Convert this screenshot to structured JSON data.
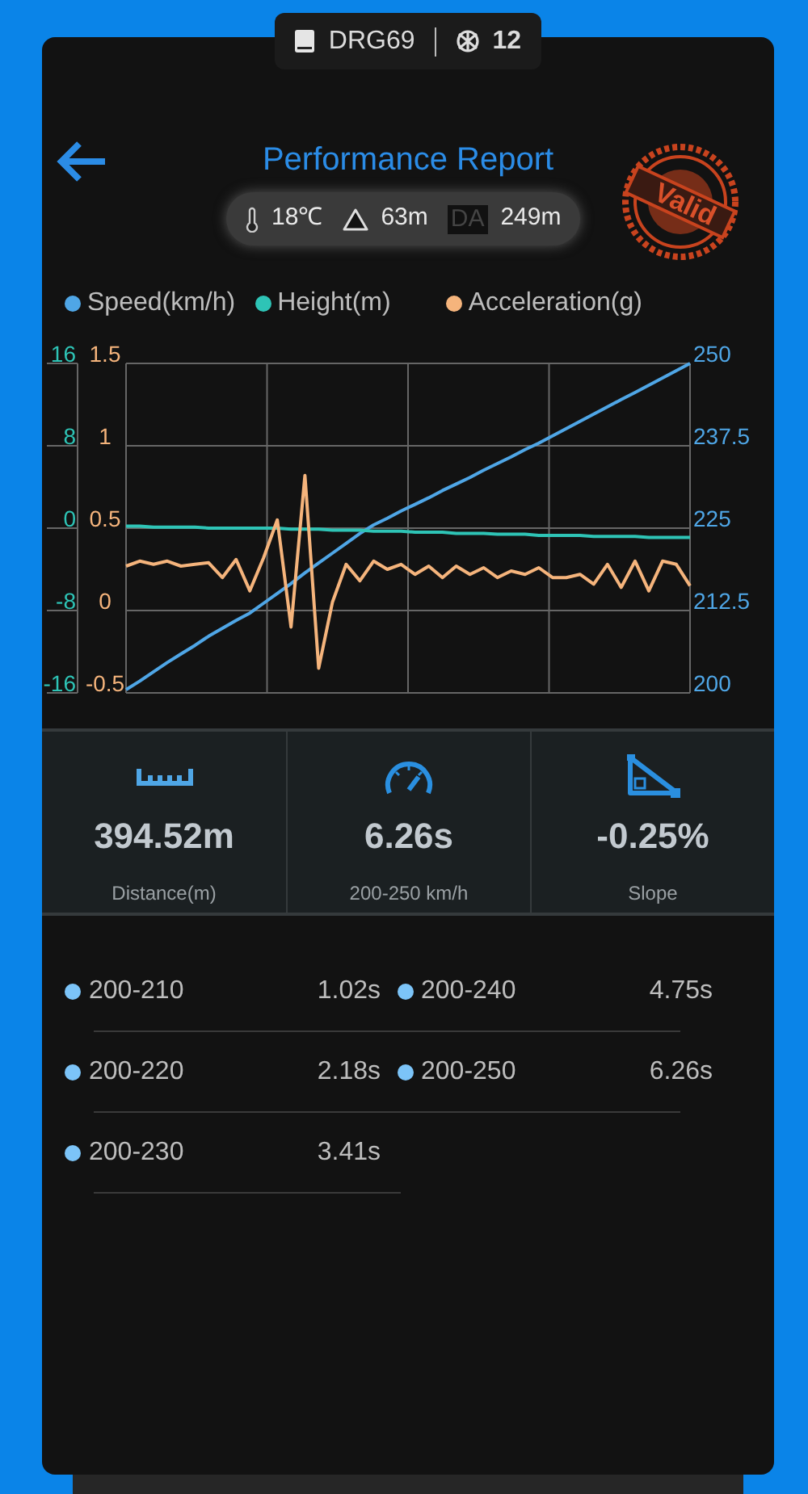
{
  "device": {
    "name": "DRG69",
    "satellites": "12"
  },
  "header": {
    "title": "Performance Report",
    "stamp": "Valid"
  },
  "conditions": {
    "temperature": "18℃",
    "altitude": "63m",
    "da_badge": "DA",
    "density_altitude": "249m"
  },
  "chart_data": {
    "type": "line",
    "grid": true,
    "ylim": [
      200,
      250
    ],
    "yticks": [
      200,
      212.5,
      225,
      237.5,
      250
    ],
    "y2lim": [
      -16,
      16
    ],
    "y2ticks": [
      -16,
      -8,
      0,
      8,
      16
    ],
    "y3lim": [
      -0.5,
      1.5
    ],
    "y3ticks": [
      -0.5,
      0,
      0.5,
      1,
      1.5
    ],
    "series": [
      {
        "name": "Speed(km/h)",
        "color": "#4fa6e6",
        "values": [
          200.5,
          201.8,
          203.2,
          204.6,
          205.9,
          207.2,
          208.6,
          209.8,
          211.0,
          212.1,
          213.6,
          215.1,
          216.6,
          218.2,
          219.7,
          221.2,
          222.7,
          224.2,
          225.5,
          226.5,
          227.6,
          228.6,
          229.6,
          230.7,
          231.7,
          232.7,
          233.8,
          234.8,
          235.8,
          236.9,
          237.9,
          239.0,
          240.1,
          241.2,
          242.3,
          243.4,
          244.5,
          245.6,
          246.7,
          247.8,
          248.9,
          250
        ]
      },
      {
        "name": "Height(m)",
        "color": "#2ec4b6",
        "axis": "y2",
        "values": [
          0.2,
          0.2,
          0.1,
          0.1,
          0.1,
          0.1,
          0.0,
          0.0,
          0.0,
          0.0,
          0.0,
          0.0,
          -0.1,
          -0.1,
          -0.1,
          -0.2,
          -0.2,
          -0.2,
          -0.3,
          -0.3,
          -0.3,
          -0.4,
          -0.4,
          -0.4,
          -0.5,
          -0.5,
          -0.5,
          -0.6,
          -0.6,
          -0.6,
          -0.7,
          -0.7,
          -0.7,
          -0.7,
          -0.8,
          -0.8,
          -0.8,
          -0.8,
          -0.9,
          -0.9,
          -0.9,
          -0.9
        ]
      },
      {
        "name": "Acceleration(g)",
        "color": "#f5b47c",
        "axis": "y3",
        "values": [
          0.27,
          0.3,
          0.28,
          0.3,
          0.27,
          0.28,
          0.29,
          0.2,
          0.31,
          0.12,
          0.32,
          0.55,
          -0.1,
          0.82,
          -0.35,
          0.05,
          0.28,
          0.18,
          0.3,
          0.25,
          0.28,
          0.22,
          0.27,
          0.2,
          0.27,
          0.22,
          0.26,
          0.2,
          0.24,
          0.22,
          0.26,
          0.2,
          0.2,
          0.22,
          0.16,
          0.28,
          0.14,
          0.3,
          0.12,
          0.3,
          0.28,
          0.15
        ]
      }
    ]
  },
  "stats": [
    {
      "kind": "distance",
      "value": "394.52m",
      "label": "Distance(m)"
    },
    {
      "kind": "time",
      "value": "6.26s",
      "label": "200-250 km/h"
    },
    {
      "kind": "slope",
      "value": "-0.25%",
      "label": "Slope"
    }
  ],
  "splits": [
    {
      "range": "200-210",
      "time": "1.02s"
    },
    {
      "range": "200-240",
      "time": "4.75s"
    },
    {
      "range": "200-220",
      "time": "2.18s"
    },
    {
      "range": "200-250",
      "time": "6.26s"
    },
    {
      "range": "200-230",
      "time": "3.41s"
    }
  ]
}
